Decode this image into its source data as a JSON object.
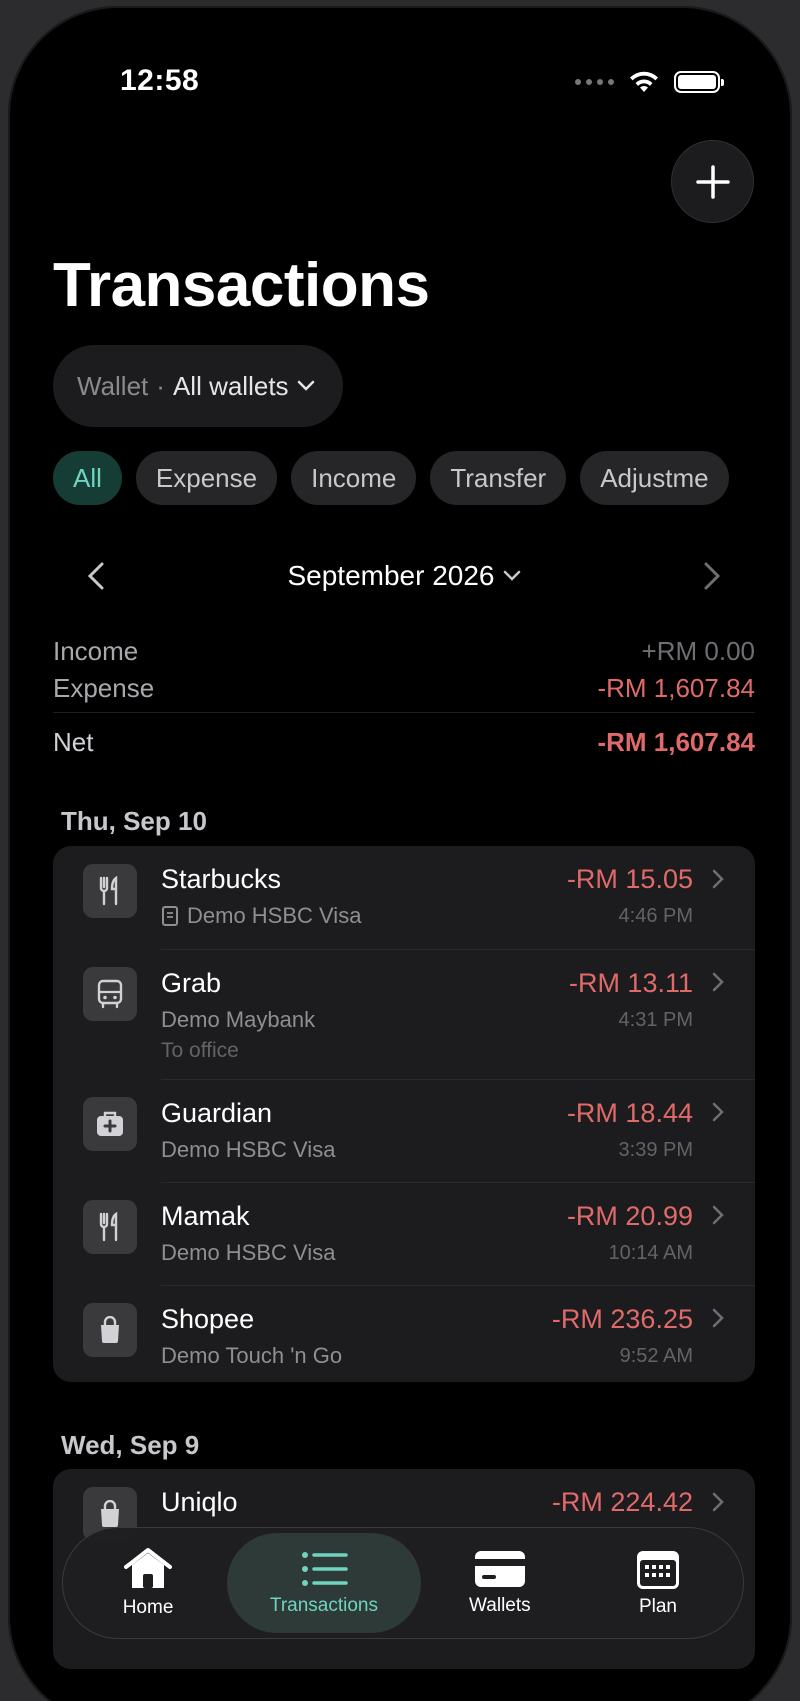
{
  "status": {
    "time": "12:58"
  },
  "header": {
    "title": "Transactions"
  },
  "wallet_filter": {
    "label": "Wallet",
    "separator": "·",
    "value": "All wallets"
  },
  "type_filters": [
    {
      "label": "All",
      "active": true
    },
    {
      "label": "Expense",
      "active": false
    },
    {
      "label": "Income",
      "active": false
    },
    {
      "label": "Transfer",
      "active": false
    },
    {
      "label": "Adjustme",
      "active": false
    }
  ],
  "month": {
    "label": "September 2026"
  },
  "summary": {
    "income_label": "Income",
    "income_value": "+RM 0.00",
    "expense_label": "Expense",
    "expense_value": "-RM 1,607.84",
    "net_label": "Net",
    "net_value": "-RM 1,607.84"
  },
  "groups": [
    {
      "date": "Thu, Sep 10",
      "items": [
        {
          "icon": "fork-knife-icon",
          "name": "Starbucks",
          "wallet": "Demo HSBC Visa",
          "receipt": true,
          "note": "",
          "amount": "-RM 15.05",
          "time": "4:46 PM"
        },
        {
          "icon": "bus-icon",
          "name": "Grab",
          "wallet": "Demo Maybank",
          "receipt": false,
          "note": "To office",
          "amount": "-RM 13.11",
          "time": "4:31 PM"
        },
        {
          "icon": "medical-bag-icon",
          "name": "Guardian",
          "wallet": "Demo HSBC Visa",
          "receipt": false,
          "note": "",
          "amount": "-RM 18.44",
          "time": "3:39 PM"
        },
        {
          "icon": "fork-knife-icon",
          "name": "Mamak",
          "wallet": "Demo HSBC Visa",
          "receipt": false,
          "note": "",
          "amount": "-RM 20.99",
          "time": "10:14 AM"
        },
        {
          "icon": "shopping-bag-icon",
          "name": "Shopee",
          "wallet": "Demo Touch 'n Go",
          "receipt": false,
          "note": "",
          "amount": "-RM 236.25",
          "time": "9:52 AM"
        }
      ]
    },
    {
      "date": "Wed, Sep 9",
      "items": [
        {
          "icon": "shopping-bag-icon",
          "name": "Uniqlo",
          "wallet": "",
          "receipt": false,
          "note": "",
          "amount": "-RM 224.42",
          "time": ""
        }
      ]
    }
  ],
  "tabbar": [
    {
      "label": "Home",
      "icon": "house-icon",
      "active": false
    },
    {
      "label": "Transactions",
      "icon": "list-icon",
      "active": true
    },
    {
      "label": "Wallets",
      "icon": "card-icon",
      "active": false
    },
    {
      "label": "Plan",
      "icon": "calendar-icon",
      "active": false
    }
  ],
  "colors": {
    "accent": "#6fd3bf",
    "negative": "#e06a6a",
    "background": "#000000",
    "card": "#1c1c1e"
  }
}
